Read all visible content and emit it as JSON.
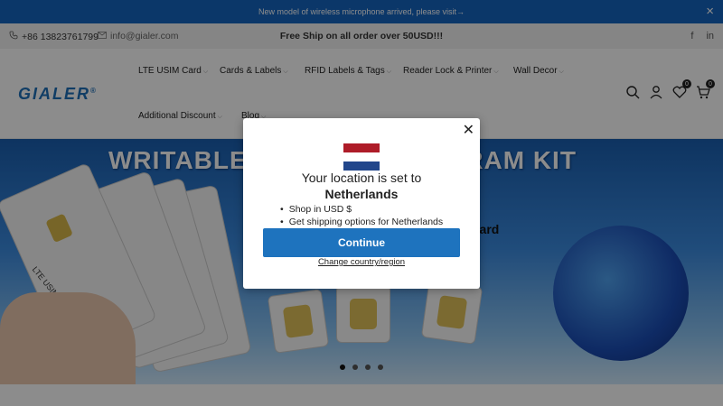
{
  "announcement": {
    "text": "New model of wireless microphone arrived, please visit→",
    "close_icon": "×"
  },
  "topbar": {
    "phone": "+86 13823761799",
    "email": "info@gialer.com",
    "shipping": "Free Ship on all order over 50USD!!!",
    "social": [
      "f",
      "in"
    ]
  },
  "header": {
    "logo": "GIALER",
    "logo_mark": "®",
    "nav": [
      {
        "label": "LTE USIM Card"
      },
      {
        "label": "Cards & Labels"
      },
      {
        "label": "RFID Labels & Tags"
      },
      {
        "label": "Reader Lock & Printer"
      },
      {
        "label": "Wall Decor"
      },
      {
        "label": "Additional Discount"
      },
      {
        "label": "Blog"
      }
    ],
    "wishlist_count": "0",
    "cart_count": "0"
  },
  "hero": {
    "title": "WRITABLE LTE USIM PROGRAM KIT",
    "subtitle": "dard",
    "card_label": "LTE USIM CARD"
  },
  "modal": {
    "line1": "Your location is set to",
    "country": "Netherlands",
    "bullets": [
      "Shop in USD $",
      "Get shipping options for Netherlands"
    ],
    "continue_label": "Continue",
    "change_label": "Change country/region",
    "flag_colors": [
      "#ae1c28",
      "#ffffff",
      "#21468b"
    ]
  }
}
